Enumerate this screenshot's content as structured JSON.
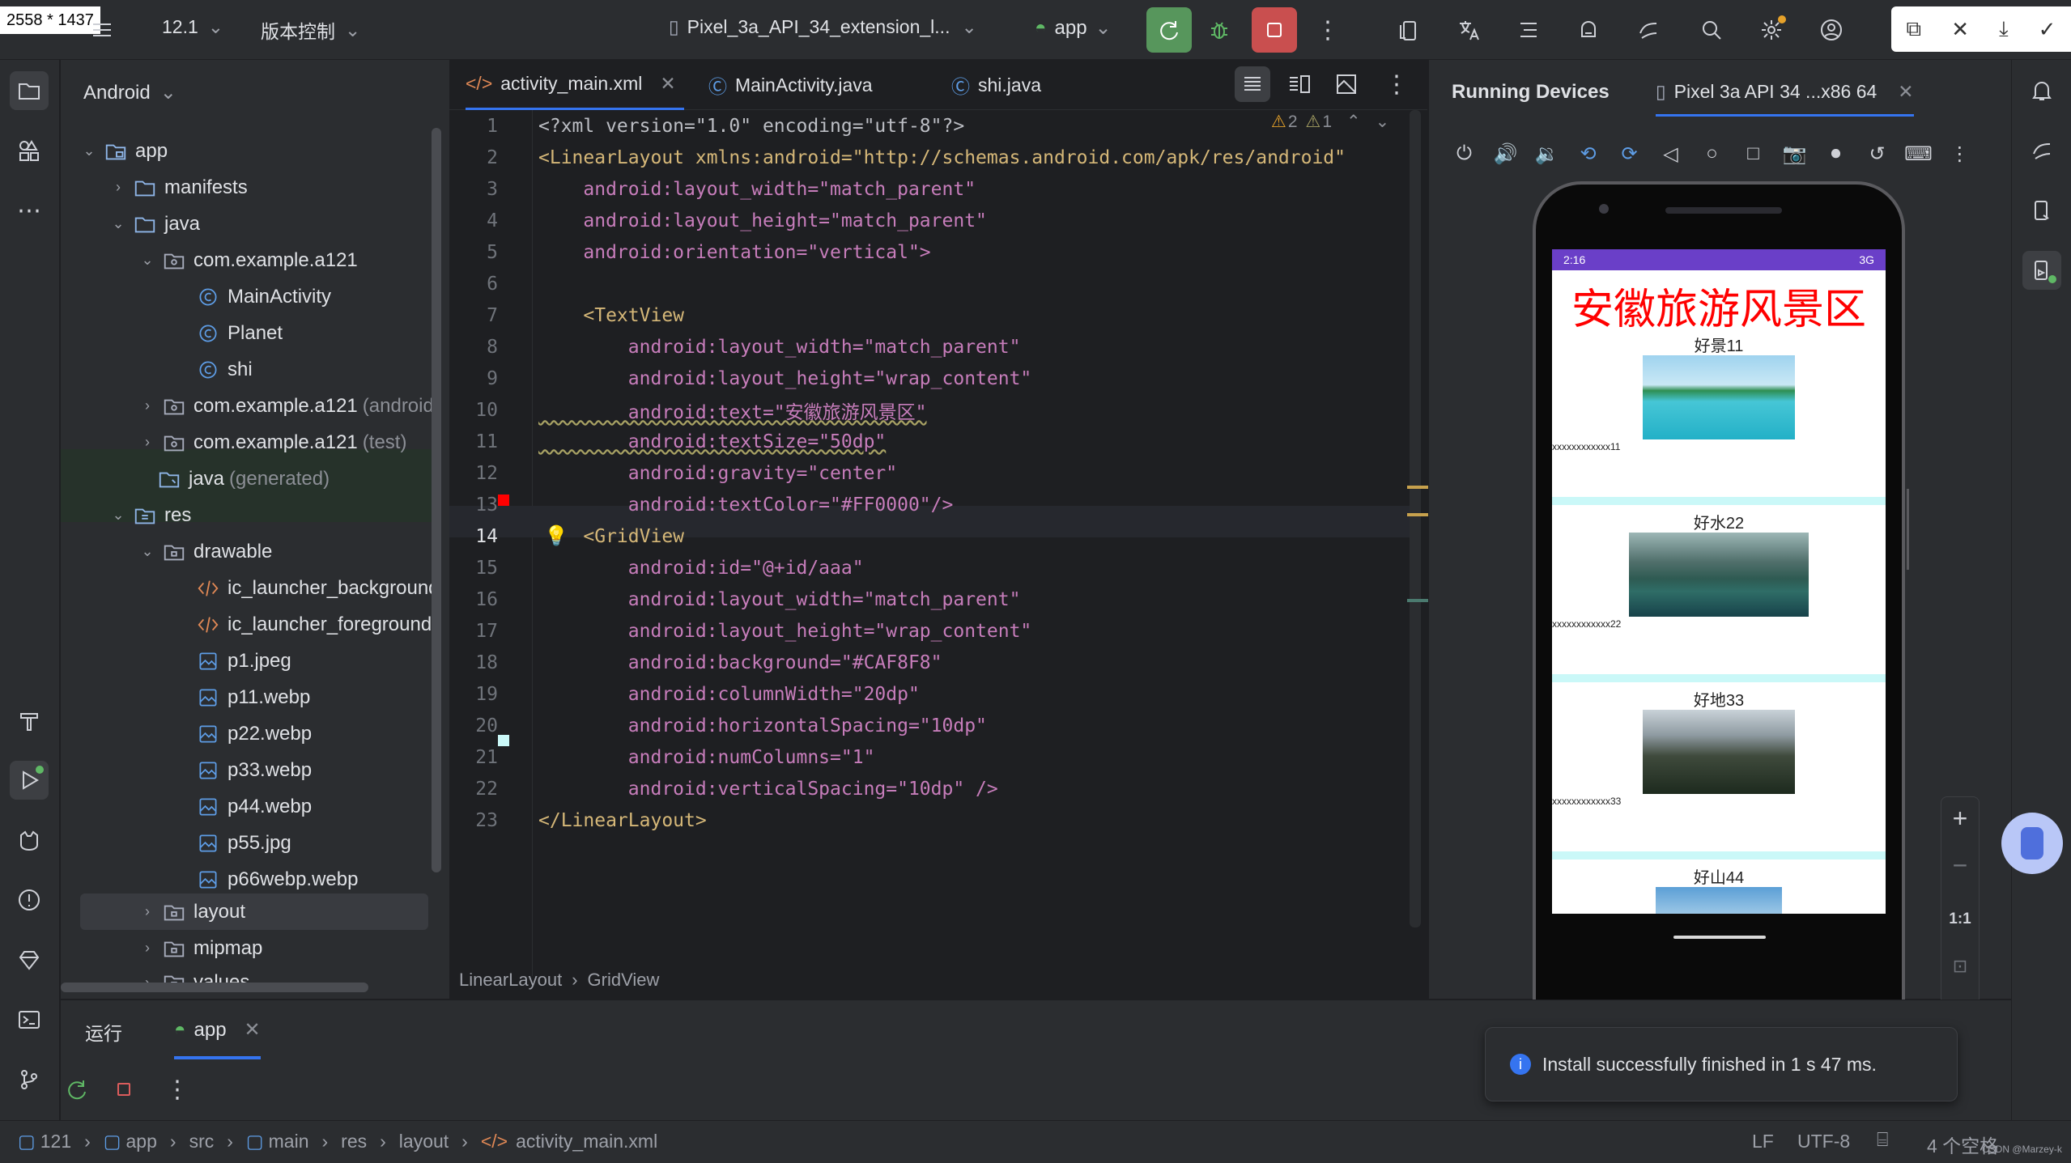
{
  "window": {
    "size_label": "2558 * 1437",
    "project_name": "12.1",
    "vcs_label": "版本控制",
    "device_selector": "Pixel_3a_API_34_extension_l...",
    "run_config": "app"
  },
  "project_panel": {
    "view_mode": "Android",
    "items": [
      {
        "label": "app",
        "suffix": ""
      },
      {
        "label": "manifests",
        "suffix": ""
      },
      {
        "label": "java",
        "suffix": ""
      },
      {
        "label": "com.example.a121",
        "suffix": ""
      },
      {
        "label": "MainActivity",
        "suffix": ""
      },
      {
        "label": "Planet",
        "suffix": ""
      },
      {
        "label": "shi",
        "suffix": ""
      },
      {
        "label": "com.example.a121",
        "suffix": "(androidTe"
      },
      {
        "label": "com.example.a121",
        "suffix": "(test)"
      },
      {
        "label": "java",
        "suffix": "(generated)"
      },
      {
        "label": "res",
        "suffix": ""
      },
      {
        "label": "drawable",
        "suffix": ""
      },
      {
        "label": "ic_launcher_background.x",
        "suffix": ""
      },
      {
        "label": "ic_launcher_foreground.xn",
        "suffix": ""
      },
      {
        "label": "p1.jpeg",
        "suffix": ""
      },
      {
        "label": "p11.webp",
        "suffix": ""
      },
      {
        "label": "p22.webp",
        "suffix": ""
      },
      {
        "label": "p33.webp",
        "suffix": ""
      },
      {
        "label": "p44.webp",
        "suffix": ""
      },
      {
        "label": "p55.jpg",
        "suffix": ""
      },
      {
        "label": "p66webp.webp",
        "suffix": ""
      },
      {
        "label": "layout",
        "suffix": ""
      },
      {
        "label": "mipmap",
        "suffix": ""
      },
      {
        "label": "values",
        "suffix": ""
      }
    ]
  },
  "editor": {
    "tabs": [
      "activity_main.xml",
      "MainActivity.java",
      "shi.java"
    ],
    "inspections": {
      "warnings": "2",
      "weak_warnings": "1"
    },
    "lines": [
      {
        "n": "1",
        "t": "<?xml version=\"1.0\" encoding=\"utf-8\"?>"
      },
      {
        "n": "2",
        "t": "<LinearLayout xmlns:android=\"http://schemas.android.com/apk/res/android\""
      },
      {
        "n": "3",
        "t": "    android:layout_width=\"match_parent\""
      },
      {
        "n": "4",
        "t": "    android:layout_height=\"match_parent\""
      },
      {
        "n": "5",
        "t": "    android:orientation=\"vertical\">"
      },
      {
        "n": "6",
        "t": ""
      },
      {
        "n": "7",
        "t": "    <TextView"
      },
      {
        "n": "8",
        "t": "        android:layout_width=\"match_parent\""
      },
      {
        "n": "9",
        "t": "        android:layout_height=\"wrap_content\""
      },
      {
        "n": "10",
        "t": "        android:text=\"安徽旅游风景区\""
      },
      {
        "n": "11",
        "t": "        android:textSize=\"50dp\""
      },
      {
        "n": "12",
        "t": "        android:gravity=\"center\""
      },
      {
        "n": "13",
        "t": "        android:textColor=\"#FF0000\"/>"
      },
      {
        "n": "14",
        "t": "    <GridView"
      },
      {
        "n": "15",
        "t": "        android:id=\"@+id/aaa\""
      },
      {
        "n": "16",
        "t": "        android:layout_width=\"match_parent\""
      },
      {
        "n": "17",
        "t": "        android:layout_height=\"wrap_content\""
      },
      {
        "n": "18",
        "t": "        android:background=\"#CAF8F8\""
      },
      {
        "n": "19",
        "t": "        android:columnWidth=\"20dp\""
      },
      {
        "n": "20",
        "t": "        android:horizontalSpacing=\"10dp\""
      },
      {
        "n": "21",
        "t": "        android:numColumns=\"1\""
      },
      {
        "n": "22",
        "t": "        android:verticalSpacing=\"10dp\" />"
      },
      {
        "n": "23",
        "t": "</LinearLayout>"
      }
    ],
    "breadcrumb": [
      "LinearLayout",
      "GridView"
    ]
  },
  "devices": {
    "title": "Running Devices",
    "tab": "Pixel 3a API 34 ...x86 64",
    "phone": {
      "time": "2:16",
      "network": "3G",
      "app_title": "安徽旅游风景区",
      "items": [
        {
          "title": "好景11",
          "caption": "xxxxxxxxxxxx11"
        },
        {
          "title": "好水22",
          "caption": "xxxxxxxxxxxx22"
        },
        {
          "title": "好地33",
          "caption": "xxxxxxxxxxxx33"
        },
        {
          "title": "好山44",
          "caption": ""
        }
      ]
    },
    "zoom_label": "1:1"
  },
  "run_panel": {
    "title": "运行",
    "tab": "app",
    "notification": "Install successfully finished in 1 s 47 ms."
  },
  "status": {
    "path": [
      "121",
      "app",
      "src",
      "main",
      "res",
      "layout",
      "activity_main.xml"
    ],
    "line_sep": "LF",
    "encoding": "UTF-8",
    "indent": "4 个空格",
    "watermark": "CSDN @Marzey-k"
  }
}
